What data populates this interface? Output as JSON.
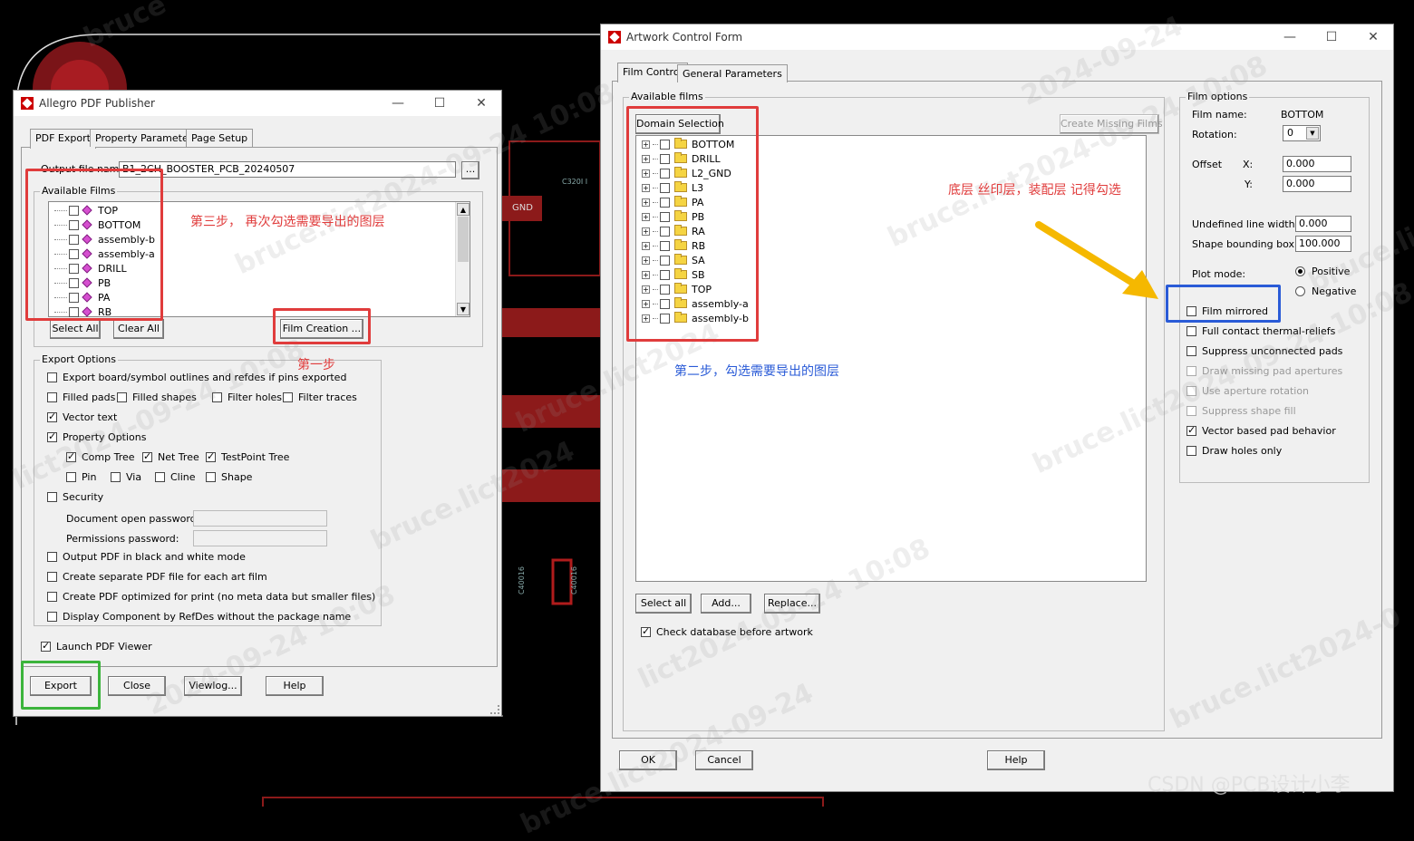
{
  "colors": {
    "annot_red": "#e03c3c",
    "annot_green": "#3cb43c",
    "annot_blue": "#2a5bd7",
    "arrow_yellow": "#f5b800",
    "note_red": "#e03c3c",
    "note_blue": "#2a5bd7"
  },
  "background": {
    "gnd_label": "GND",
    "c3207_label": "C320I I",
    "c4001_label": "C40016",
    "c4002_label": "C40016",
    "watermark": "CSDN @PCB设计小李",
    "wm_texts": [
      "bruce",
      "bruce.lict2024-09-24 10:08",
      "lict2024-09-24 10:08",
      "bruce.lict2024",
      "2024-09-24 10:08",
      "bruce.lict2024-09-24",
      "bruce.lict2024-09-24 10:08",
      "lict2024-09-24 10:08",
      "bruce.lict2024-09-24 10:08",
      "bruce.lict2024-0",
      "bruce.lict2024",
      "2024-09-24",
      "bruce.li"
    ]
  },
  "pdf": {
    "title": "Allegro PDF Publisher",
    "minimize": "—",
    "maximize": "☐",
    "close": "✕",
    "tabs": [
      "PDF Export",
      "Property Parameters",
      "Page Setup"
    ],
    "output_label": "Output file name:",
    "output_value": "B1_2CH_BOOSTER_PCB_20240507",
    "browse": "...",
    "films_label": "Available Films",
    "films": [
      "TOP",
      "BOTTOM",
      "assembly-b",
      "assembly-a",
      "DRILL",
      "PB",
      "PA",
      "RB"
    ],
    "select_all": "Select All",
    "clear_all": "Clear All",
    "film_creation": "Film Creation ...",
    "export_options_label": "Export Options",
    "opt_outlines": "Export board/symbol outlines and refdes if pins exported",
    "filled_pads": "Filled pads",
    "filled_shapes": "Filled shapes",
    "filter_holes": "Filter holes",
    "filter_traces": "Filter traces",
    "vector_text": "Vector text",
    "property_options": "Property Options",
    "comp_tree": "Comp Tree",
    "net_tree": "Net Tree",
    "testpoint_tree": "TestPoint Tree",
    "pin": "Pin",
    "via": "Via",
    "cline": "Cline",
    "shape": "Shape",
    "security": "Security",
    "doc_pw": "Document open password:",
    "perm_pw": "Permissions password:",
    "bw_mode": "Output PDF in black and white mode",
    "separate": "Create separate PDF file for each art film",
    "optimized": "Create PDF optimized for print (no meta data but smaller files)",
    "refdes": "Display Component by RefDes without the package name",
    "launch": "Launch PDF Viewer",
    "export": "Export",
    "close_btn": "Close",
    "viewlog": "Viewlog...",
    "help": "Help",
    "note_step3": "第三步， 再次勾选需要导出的图层",
    "note_step1": "第一步"
  },
  "art": {
    "title": "Artwork Control Form",
    "minimize": "—",
    "maximize": "☐",
    "close": "✕",
    "tabs": [
      "Film Control",
      "General Parameters"
    ],
    "available_films": "Available films",
    "domain_selection": "Domain Selection",
    "create_missing": "Create Missing Films",
    "films": [
      "BOTTOM",
      "DRILL",
      "L2_GND",
      "L3",
      "PA",
      "PB",
      "RA",
      "RB",
      "SA",
      "SB",
      "TOP",
      "assembly-a",
      "assembly-b"
    ],
    "select_all": "Select all",
    "add": "Add...",
    "replace": "Replace...",
    "check_db": "Check database before artwork",
    "film_options": "Film options",
    "film_name_label": "Film name:",
    "film_name": "BOTTOM",
    "rotation_label": "Rotation:",
    "rotation": "0",
    "offset_label": "Offset",
    "x_label": "X:",
    "y_label": "Y:",
    "offset_x": "0.000",
    "offset_y": "0.000",
    "undef_label": "Undefined line width:",
    "undef_value": "0.000",
    "shape_label": "Shape bounding box:",
    "shape_value": "100.000",
    "plot_mode": "Plot mode:",
    "positive": "Positive",
    "negative": "Negative",
    "film_mirrored": "Film mirrored",
    "full_contact": "Full contact thermal-reliefs",
    "suppress_unconn": "Suppress unconnected pads",
    "draw_missing": "Draw missing pad apertures",
    "use_aperture": "Use aperture rotation",
    "suppress_fill": "Suppress shape fill",
    "vector_pad": "Vector based pad behavior",
    "draw_holes": "Draw holes only",
    "ok": "OK",
    "cancel": "Cancel",
    "help": "Help",
    "note_layers": "底层 丝印层，装配层 记得勾选",
    "note_step2": "第二步，勾选需要导出的图层"
  }
}
